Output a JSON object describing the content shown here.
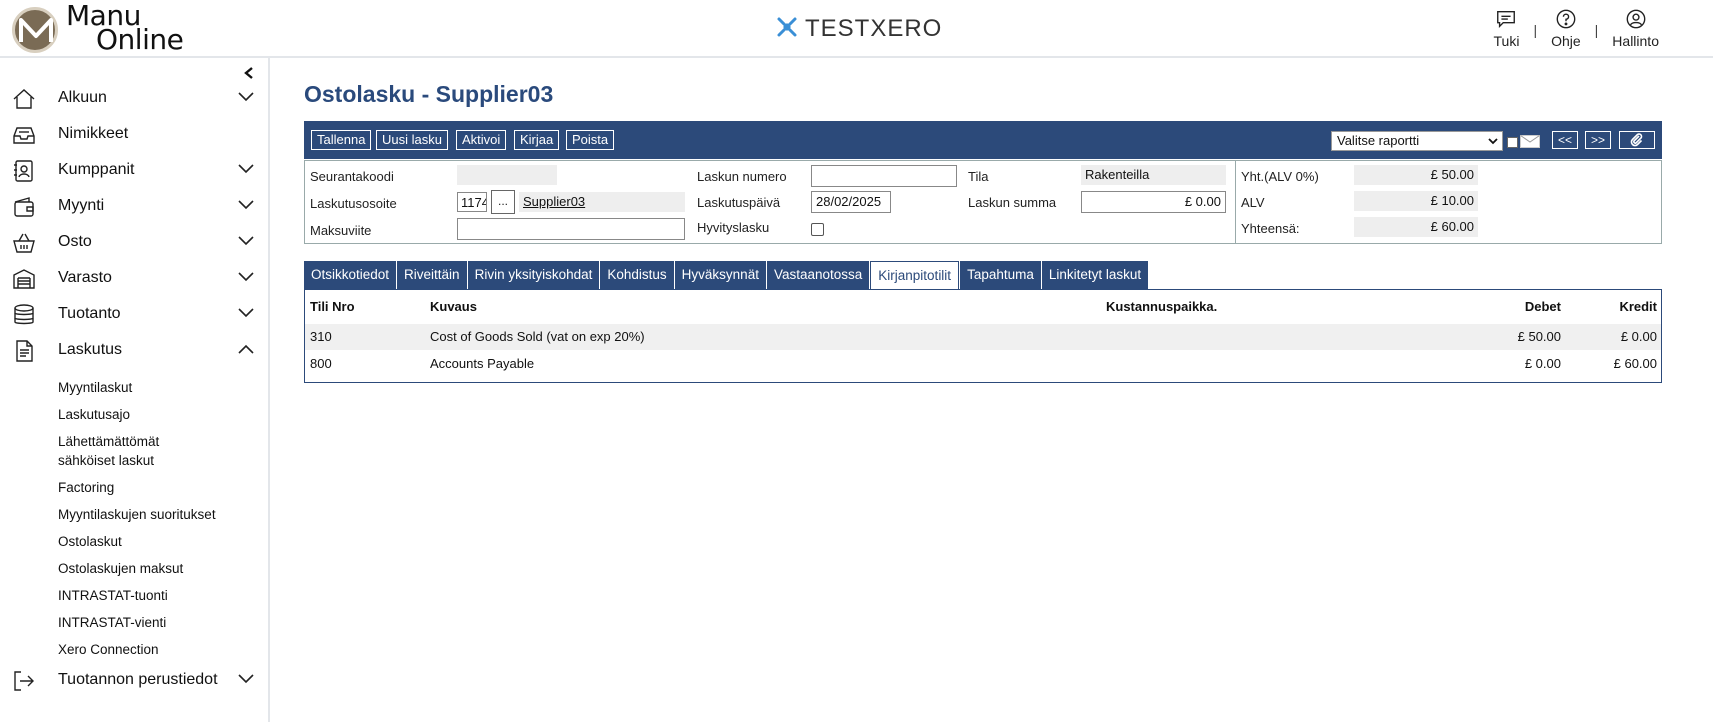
{
  "header": {
    "logo_line1": "Manu",
    "logo_line2": "Online",
    "brand": "TESTXERO",
    "actions": [
      {
        "label": "Tuki",
        "icon": "chat-icon"
      },
      {
        "label": "Ohje",
        "icon": "help-icon"
      },
      {
        "label": "Hallinto",
        "icon": "user-icon"
      }
    ],
    "separator": "|"
  },
  "sidebar": {
    "items": [
      {
        "label": "Alkuun",
        "icon": "home-icon",
        "expandable": true
      },
      {
        "label": "Nimikkeet",
        "icon": "inbox-icon",
        "expandable": false
      },
      {
        "label": "Kumppanit",
        "icon": "contacts-icon",
        "expandable": true
      },
      {
        "label": "Myynti",
        "icon": "wallet-icon",
        "expandable": true
      },
      {
        "label": "Osto",
        "icon": "basket-icon",
        "expandable": true
      },
      {
        "label": "Varasto",
        "icon": "warehouse-icon",
        "expandable": true
      },
      {
        "label": "Tuotanto",
        "icon": "database-icon",
        "expandable": true
      },
      {
        "label": "Laskutus",
        "icon": "document-icon",
        "expandable": true,
        "expanded": true
      }
    ],
    "sub_items": [
      "Myyntilaskut",
      "Laskutusajo",
      "Lähettämättömät sähköiset laskut",
      "Factoring",
      "Myyntilaskujen suoritukset",
      "Ostolaskut",
      "Ostolaskujen maksut",
      "INTRASTAT-tuonti",
      "INTRASTAT-vienti",
      "Xero Connection"
    ],
    "bottom_item": {
      "label": "Tuotannon perustiedot",
      "icon": "exit-icon"
    }
  },
  "page": {
    "title": "Ostolasku - Supplier03"
  },
  "toolbar": {
    "buttons": [
      "Tallenna",
      "Uusi lasku",
      "Aktivoi",
      "Kirjaa",
      "Poista"
    ],
    "report_select": "Valitse raportti",
    "prev": "<<",
    "next": ">>"
  },
  "form": {
    "seurantakoodi_label": "Seurantakoodi",
    "seurantakoodi_value": "",
    "laskutusosoite_label": "Laskutusosoite",
    "laskutusosoite_id": "1174",
    "lookup_btn": "...",
    "supplier_link": "Supplier03",
    "maksuviite_label": "Maksuviite",
    "maksuviite_value": "",
    "laskun_numero_label": "Laskun numero",
    "laskun_numero_value": "",
    "laskutuspaiva_label": "Laskutuspäivä",
    "laskutuspaiva_value": "28/02/2025",
    "hyvityslasku_label": "Hyvityslasku",
    "tila_label": "Tila",
    "tila_value": "Rakenteilla",
    "laskun_summa_label": "Laskun summa",
    "laskun_summa_value": "£ 0.00",
    "yht_label": "Yht.(ALV 0%)",
    "yht_value": "£ 50.00",
    "alv_label": "ALV",
    "alv_value": "£ 10.00",
    "yhteensa_label": "Yhteensä:",
    "yhteensa_value": "£ 60.00"
  },
  "tabs": [
    {
      "label": "Otsikkotiedot",
      "active": false
    },
    {
      "label": "Riveittäin",
      "active": false
    },
    {
      "label": "Rivin yksityiskohdat",
      "active": false
    },
    {
      "label": "Kohdistus",
      "active": false
    },
    {
      "label": "Hyväksynnät",
      "active": false
    },
    {
      "label": "Vastaanotossa",
      "active": false
    },
    {
      "label": "Kirjanpitotilit",
      "active": true
    },
    {
      "label": "Tapahtuma",
      "active": false
    },
    {
      "label": "Linkitetyt laskut",
      "active": false
    }
  ],
  "grid": {
    "headers": {
      "tili": "Tili Nro",
      "kuvaus": "Kuvaus",
      "kustannus": "Kustannuspaikka.",
      "debet": "Debet",
      "kredit": "Kredit"
    },
    "rows": [
      {
        "tili": "310",
        "kuvaus": "Cost of Goods Sold (vat on exp 20%)",
        "kustannus": "",
        "debet": "£ 50.00",
        "kredit": "£ 0.00"
      },
      {
        "tili": "800",
        "kuvaus": "Accounts Payable",
        "kustannus": "",
        "debet": "£ 0.00",
        "kredit": "£ 60.00"
      }
    ]
  },
  "colors": {
    "accent": "#2c4a7a",
    "title": "#2a4a7c",
    "brand_icon": "#3a8fd6"
  }
}
